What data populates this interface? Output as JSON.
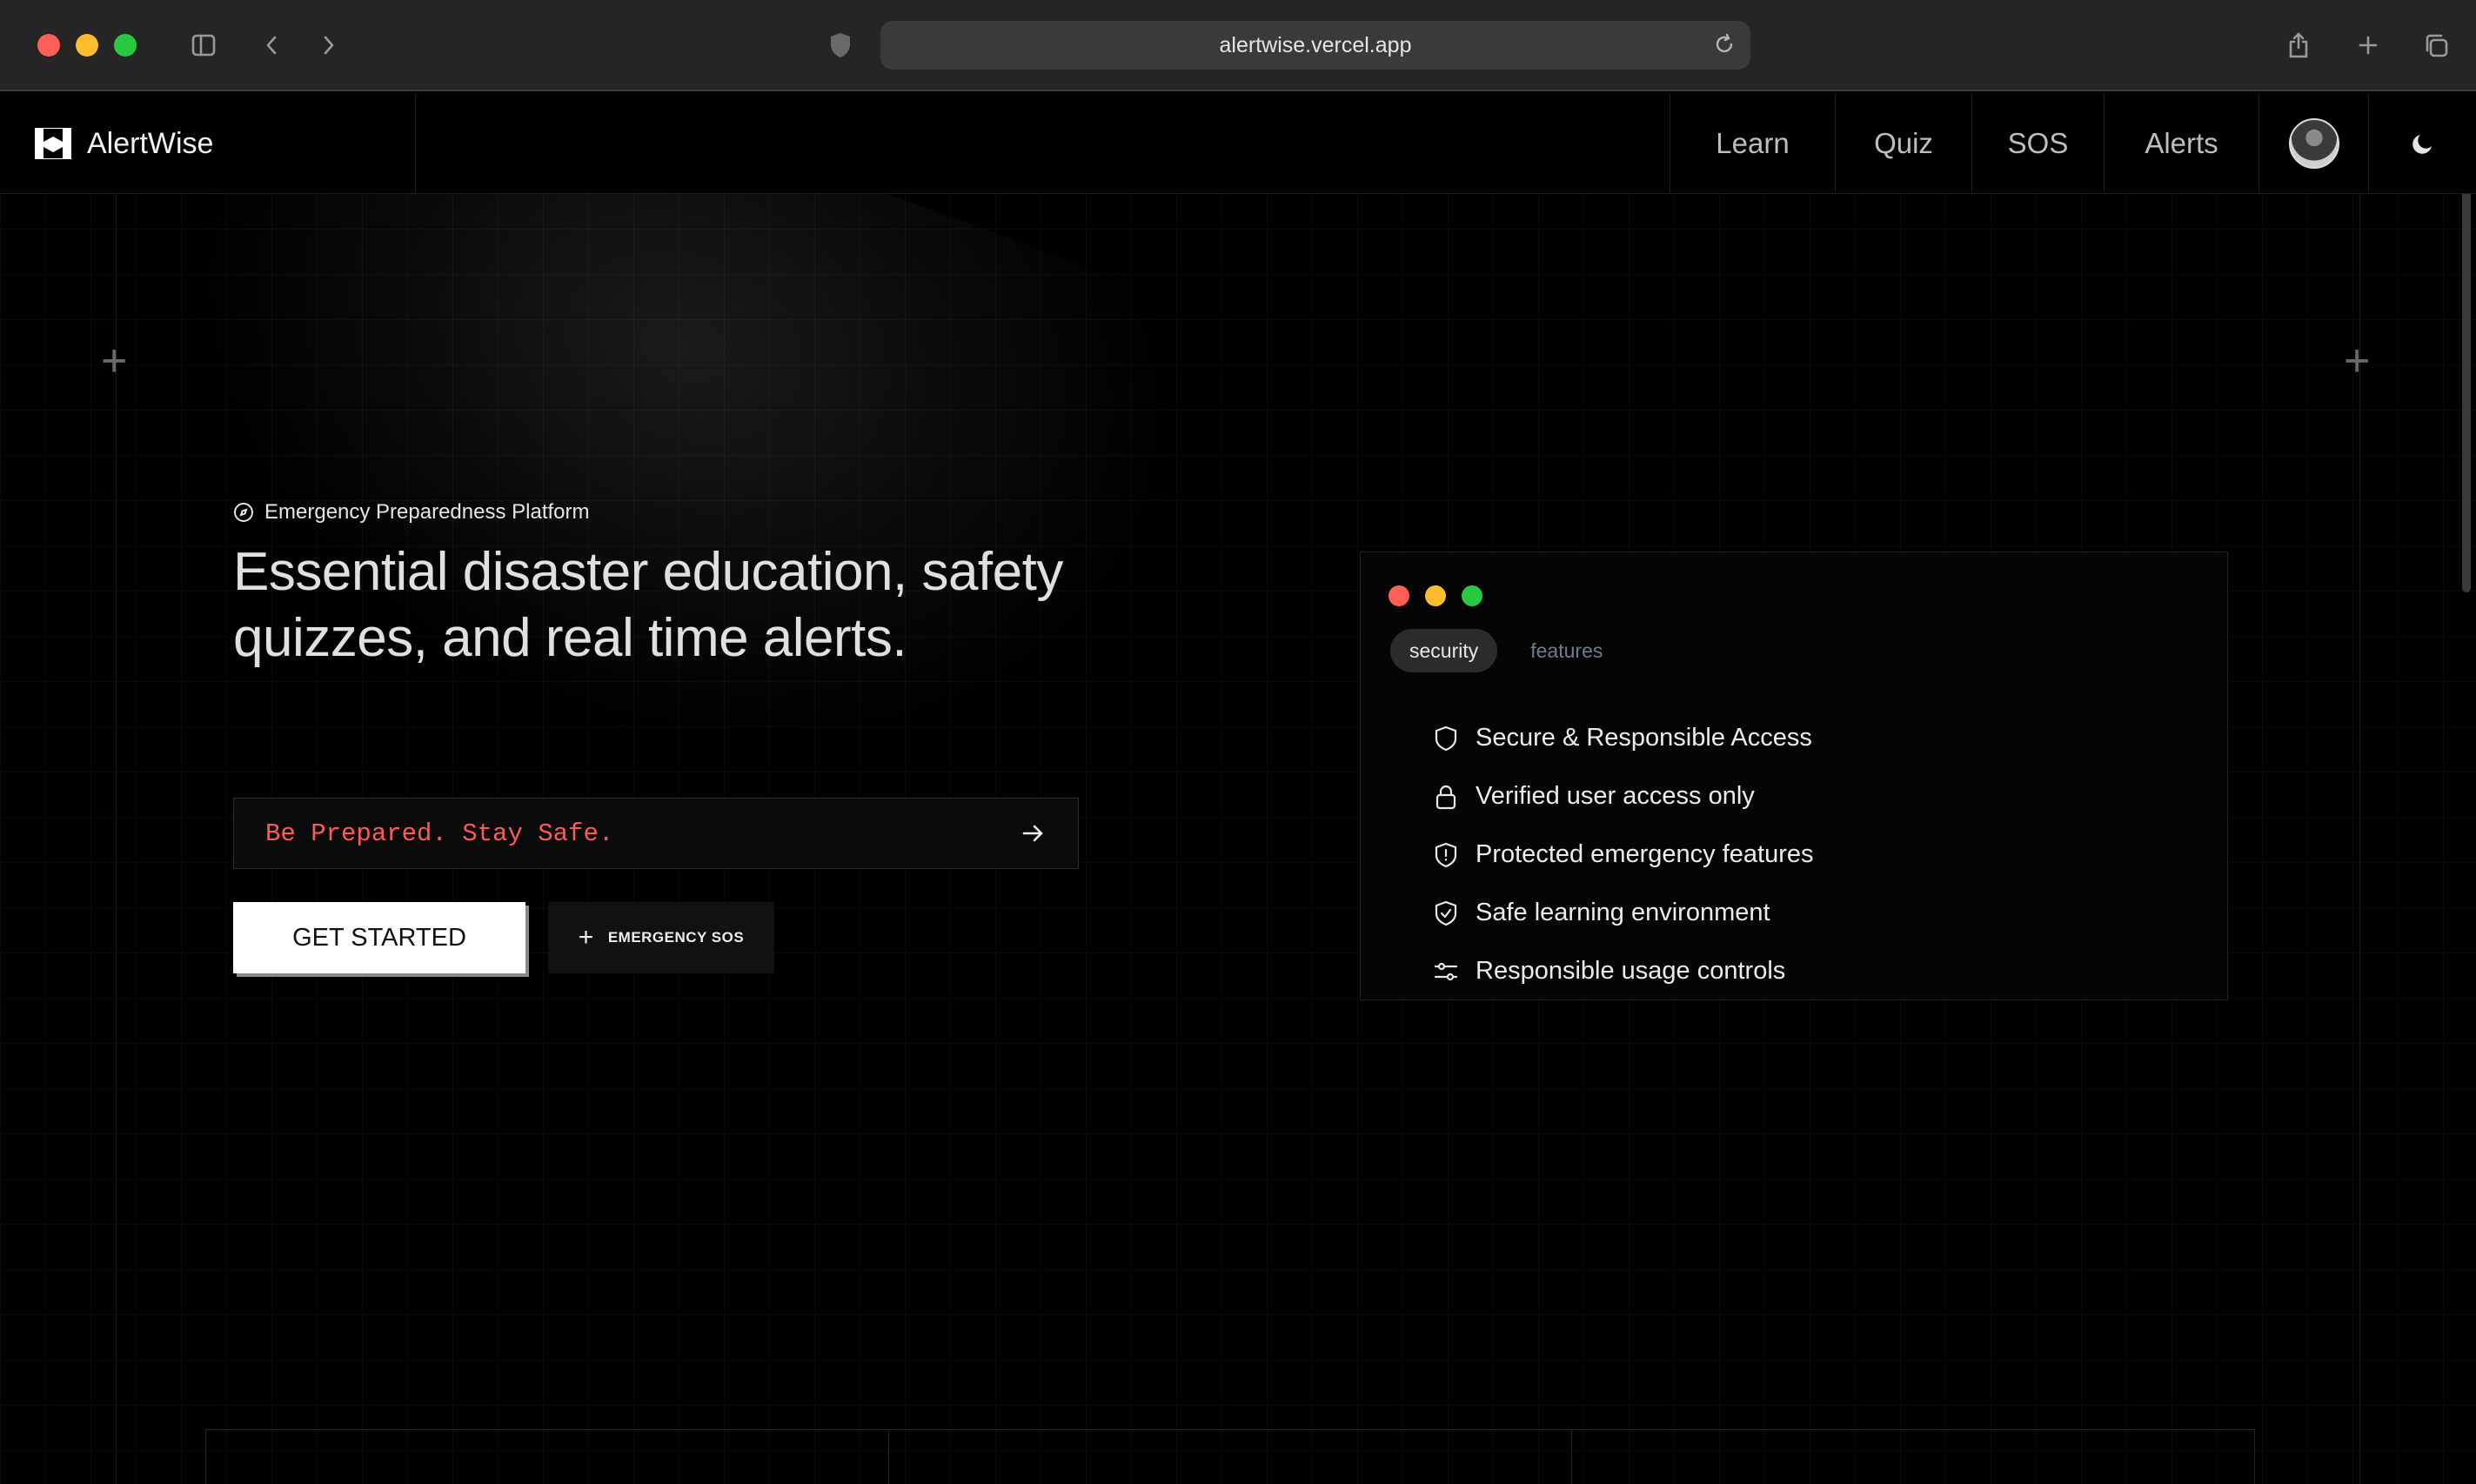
{
  "browser": {
    "url": "alertwise.vercel.app"
  },
  "nav": {
    "brand": "AlertWise",
    "links": [
      "Learn",
      "Quiz",
      "SOS",
      "Alerts"
    ]
  },
  "hero": {
    "eyebrow": "Emergency Preparedness Platform",
    "headline": "Essential disaster education, safety quizzes, and real time alerts.",
    "tagline": "Be Prepared. Stay Safe.",
    "primary_button": "GET STARTED",
    "secondary_button": "EMERGENCY SOS"
  },
  "card": {
    "tabs": [
      "security",
      "features"
    ],
    "active_tab": "security",
    "features": [
      {
        "icon": "shield-icon",
        "label": "Secure & Responsible Access"
      },
      {
        "icon": "lock-icon",
        "label": "Verified user access only"
      },
      {
        "icon": "shield-alert-icon",
        "label": "Protected emergency features"
      },
      {
        "icon": "shield-check-icon",
        "label": "Safe learning environment"
      },
      {
        "icon": "sliders-icon",
        "label": "Responsible usage controls"
      }
    ]
  },
  "colors": {
    "accent_red": "#ff5a5a",
    "background": "#000000"
  }
}
